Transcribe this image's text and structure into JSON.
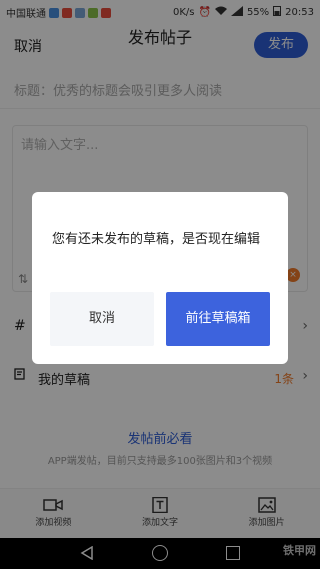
{
  "colors": {
    "accent": "#2e5dd6",
    "dialog_primary": "#3d63dd",
    "orange": "#f07a2a"
  },
  "status_bar": {
    "carrier": "中国联通",
    "speed": "0K/s",
    "battery": "55%",
    "time": "20:53"
  },
  "header": {
    "cancel": "取消",
    "title": "发布帖子",
    "publish": "发布"
  },
  "editor": {
    "title_placeholder": "标题：优秀的标题会吸引更多人阅读",
    "content_placeholder": "请输入文字..."
  },
  "rows": [
    {
      "icon": "#",
      "label": "",
      "count": ""
    },
    {
      "icon": "🗒",
      "label": "我的草稿",
      "count": "1条"
    }
  ],
  "footer": {
    "must_read": "发帖前必看",
    "note": "APP端发帖，目前只支持最多100张图片和3个视频"
  },
  "toolbar": {
    "add_video": "添加视频",
    "add_text": "添加文字",
    "add_image": "添加图片"
  },
  "watermark": "铁甲网",
  "dialog": {
    "message": "您有还未发布的草稿，是否现在编辑",
    "cancel": "取消",
    "confirm": "前往草稿箱"
  }
}
